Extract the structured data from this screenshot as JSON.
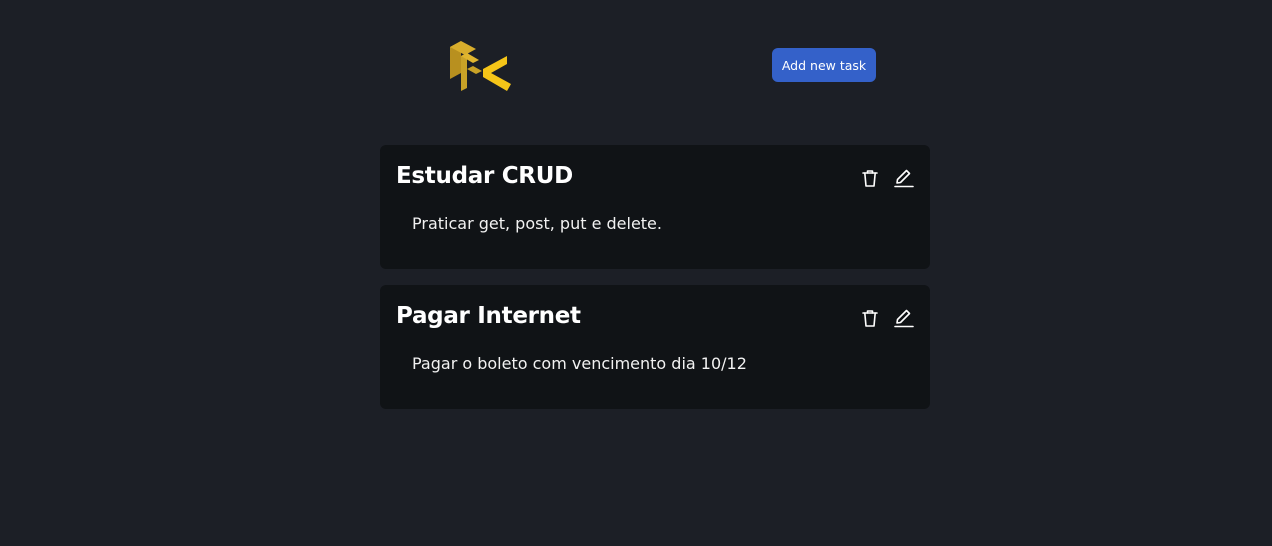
{
  "app": {
    "logo_icon": "fk-logo-icon",
    "accent_color": "#3461c9",
    "background_color": "#1c1f26",
    "card_color": "#101316",
    "logo_colors": [
      "#c9a227",
      "#f5c518"
    ]
  },
  "header": {
    "add_button_label": "Add new task"
  },
  "tasks": [
    {
      "title": "Estudar CRUD",
      "description": "Praticar get, post, put e delete.",
      "delete_icon": "trash-icon",
      "edit_icon": "pencil-icon"
    },
    {
      "title": "Pagar Internet",
      "description": "Pagar o boleto com vencimento dia 10/12",
      "delete_icon": "trash-icon",
      "edit_icon": "pencil-icon"
    }
  ]
}
